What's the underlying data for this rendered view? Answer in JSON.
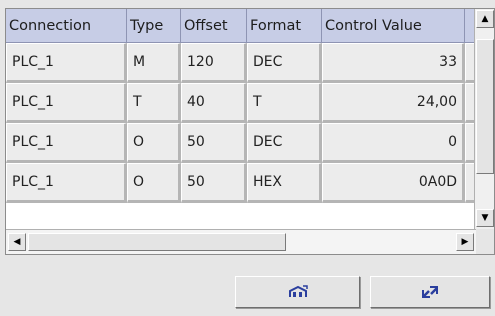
{
  "columns": [
    "Connection",
    "Type",
    "Offset",
    "Format",
    "Control Value"
  ],
  "rows": [
    {
      "connection": "PLC_1",
      "type": "M",
      "offset": "120",
      "format": "DEC",
      "control_value": "33"
    },
    {
      "connection": "PLC_1",
      "type": "T",
      "offset": "40",
      "format": "T",
      "control_value": "24,00"
    },
    {
      "connection": "PLC_1",
      "type": "O",
      "offset": "50",
      "format": "DEC",
      "control_value": "0"
    },
    {
      "connection": "PLC_1",
      "type": "O",
      "offset": "50",
      "format": "HEX",
      "control_value": "0A0D"
    }
  ],
  "colors": {
    "header_bg": "#c7cde6",
    "cell_bg": "#ececec",
    "window_bg": "#e6e6e6",
    "icon_blue": "#2b3f9e"
  },
  "buttons": [
    {
      "icon": "read-values-icon"
    },
    {
      "icon": "write-values-icon"
    }
  ]
}
